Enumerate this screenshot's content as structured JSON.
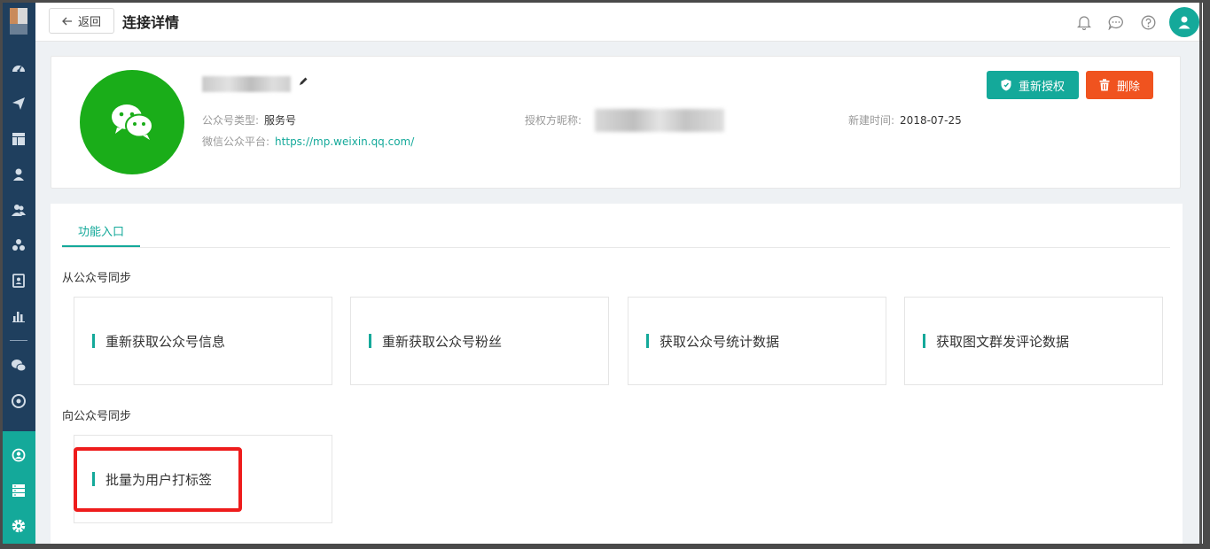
{
  "topbar": {
    "back_label": "返回",
    "title": "连接详情"
  },
  "account": {
    "type_label": "公众号类型:",
    "type_value": "服务号",
    "platform_label": "微信公众平台:",
    "platform_url": "https://mp.weixin.qq.com/",
    "auth_label": "授权方昵称:",
    "created_label": "新建时间:",
    "created_value": "2018-07-25"
  },
  "actions": {
    "reauth_label": "重新授权",
    "delete_label": "删除"
  },
  "tabs": [
    {
      "label": "功能入口"
    }
  ],
  "sections": [
    {
      "title": "从公众号同步",
      "cards": [
        "重新获取公众号信息",
        "重新获取公众号粉丝",
        "获取公众号统计数据",
        "获取图文群发评论数据"
      ]
    },
    {
      "title": "向公众号同步",
      "cards": [
        "批量为用户打标签"
      ]
    }
  ],
  "colors": {
    "accent": "#14a99a",
    "sidebar": "#1f3f5e",
    "danger": "#f0531f",
    "wechat": "#1aad19",
    "highlight": "#ee1c1c"
  },
  "sidebar_icons": [
    "dashboard-icon",
    "send-icon",
    "layout-icon",
    "user-icon",
    "users-icon",
    "cluster-icon",
    "contact-icon",
    "bar-chart-icon",
    "wechat-icon",
    "target-icon",
    "network-icon",
    "server-icon",
    "settings-icon"
  ]
}
